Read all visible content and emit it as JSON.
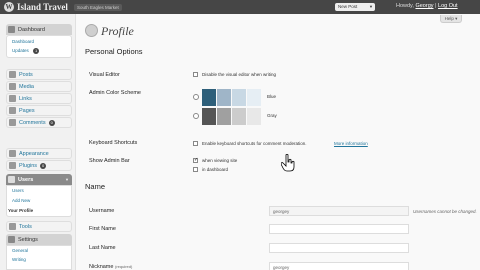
{
  "header": {
    "site_title": "Island Travel",
    "site_link": "South Eagles Market",
    "new_post": "New Post",
    "howdy": "Howdy,",
    "user": "Georgy",
    "sep": "|",
    "logout": "Log Out"
  },
  "help": "Help",
  "sidebar": {
    "dashboard": "Dashboard",
    "dash_sub1": "Dashboard",
    "dash_sub2": "Updates",
    "updates_count": "1",
    "posts": "Posts",
    "media": "Media",
    "links": "Links",
    "pages": "Pages",
    "comments": "Comments",
    "comments_count": "0",
    "appearance": "Appearance",
    "plugins": "Plugins",
    "plugins_count": "0",
    "users": "Users",
    "users_sub1": "Users",
    "users_sub2": "Add New",
    "users_sub3": "Your Profile",
    "tools": "Tools",
    "settings": "Settings",
    "settings_sub1": "General",
    "settings_sub2": "Writing"
  },
  "page": {
    "title": "Profile",
    "personal_options": "Personal Options",
    "visual_editor_label": "Visual Editor",
    "visual_editor_text": "Disable the visual editor when writing",
    "admin_color_label": "Admin Color Scheme",
    "blue": "Blue",
    "gray": "Gray",
    "keyboard_label": "Keyboard Shortcuts",
    "keyboard_text": "Enable keyboard shortcuts for comment moderation.",
    "more_info": "More information",
    "admin_bar_label": "Show Admin Bar",
    "when_viewing": "when viewing site",
    "in_dashboard": "in dashboard",
    "name_section": "Name",
    "username_label": "Username",
    "username_value": "georgey",
    "username_note": "Usernames cannot be changed.",
    "first_name_label": "First Name",
    "last_name_label": "Last Name",
    "nickname_label": "Nickname",
    "required": "(required)",
    "nickname_value": "georgey"
  },
  "colors": {
    "blue_scheme": [
      "#2e5f7a",
      "#9fb5c8",
      "#c8d8e4",
      "#e6eef4"
    ],
    "gray_scheme": [
      "#555555",
      "#a0a0a0",
      "#cccccc",
      "#e8e8e8"
    ]
  }
}
